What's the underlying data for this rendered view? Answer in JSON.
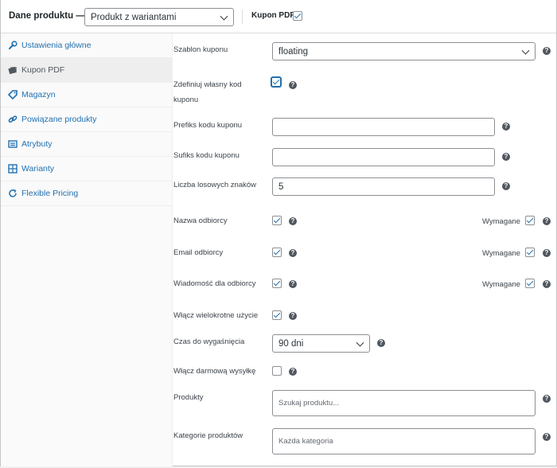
{
  "header": {
    "title": "Dane produktu —",
    "product_type": "Produkt z wariantami",
    "coupon_label": "Kupon PDF:",
    "coupon_checked": true
  },
  "sidebar": {
    "items": [
      {
        "label": "Ustawienia główne",
        "icon": "wrench-icon"
      },
      {
        "label": "Kupon PDF",
        "icon": "ticket-icon",
        "active": true
      },
      {
        "label": "Magazyn",
        "icon": "tag-icon"
      },
      {
        "label": "Powiązane produkty",
        "icon": "link-icon"
      },
      {
        "label": "Atrybuty",
        "icon": "list-icon"
      },
      {
        "label": "Warianty",
        "icon": "grid-icon"
      },
      {
        "label": "Flexible Pricing",
        "icon": "refresh-icon"
      }
    ]
  },
  "fields": {
    "template_label": "Szablon kuponu",
    "template_value": "floating",
    "custom_code_label_1": "Zdefiniuj własny kod",
    "custom_code_label_2": "kuponu",
    "prefix_label": "Prefiks kodu kuponu",
    "prefix_value": "",
    "suffix_label": "Sufiks kodu kuponu",
    "suffix_value": "",
    "random_chars_label": "Liczba losowych znaków",
    "random_chars_value": "5",
    "recipient_name_label": "Nazwa odbiorcy",
    "recipient_email_label": "Email odbiorcy",
    "recipient_message_label": "Wiadomość dla odbiorcy",
    "required_label": "Wymagane",
    "multiple_use_label": "Włącz wielokrotne użycie",
    "expiry_label": "Czas do wygaśnięcia",
    "expiry_value": "90 dni",
    "free_shipping_label": "Włącz darmową wysyłkę",
    "products_label": "Produkty",
    "products_placeholder": "Szukaj produktu...",
    "categories_label": "Kategorie produktów",
    "categories_placeholder": "Każda kategoria"
  },
  "help_glyph": "?",
  "colors": {
    "accent": "#2271b1",
    "help": "#50575e"
  }
}
